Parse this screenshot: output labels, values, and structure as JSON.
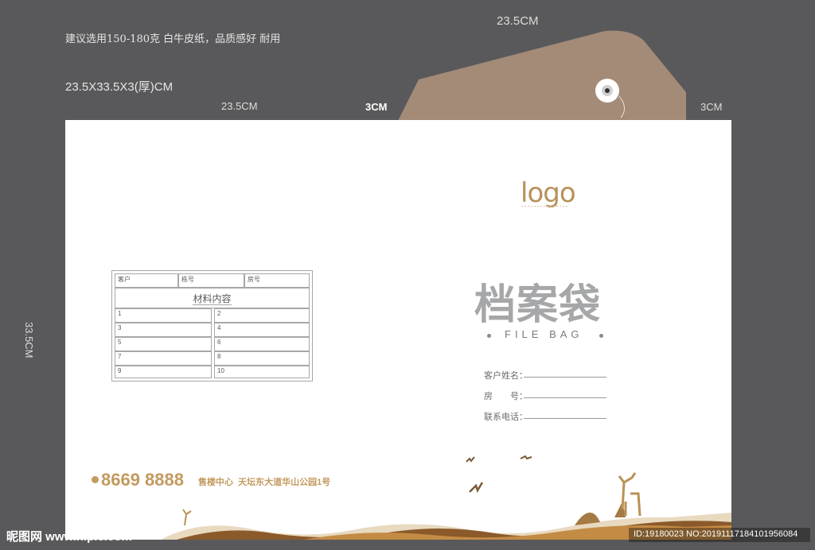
{
  "spec": {
    "paper_note": "建议选用150-180克 白牛皮纸，品质感好 耐用",
    "dimensions": "23.5X33.5X3(厚)CM"
  },
  "dims": {
    "top_flap": "23.5CM",
    "back_width": "23.5CM",
    "spine": "3CM",
    "right_edge": "3CM",
    "height": "33.5CM"
  },
  "front": {
    "logo": "logo",
    "title": "档案袋",
    "subtitle": "FILE BAG",
    "fields": [
      {
        "label": "客户姓名："
      },
      {
        "label": "房　　号："
      },
      {
        "label": "联系电话："
      }
    ]
  },
  "form": {
    "header": [
      "客户",
      "栋号",
      "房号"
    ],
    "section_title": "材料内容",
    "rows": [
      [
        "1",
        "2"
      ],
      [
        "3",
        "4"
      ],
      [
        "5",
        "6"
      ],
      [
        "7",
        "8"
      ],
      [
        "9",
        "10"
      ]
    ]
  },
  "contact": {
    "phone": "8669 8888",
    "sales_label": "售楼中心",
    "address": "天坛东大道华山公园1号"
  },
  "watermark": {
    "left": "昵图网 www.nipic.com",
    "right": "ID:19180023 NO:20191117184101956084"
  },
  "colors": {
    "background": "#59595b",
    "flap": "#a38b78",
    "gold": "#c39a5f"
  }
}
